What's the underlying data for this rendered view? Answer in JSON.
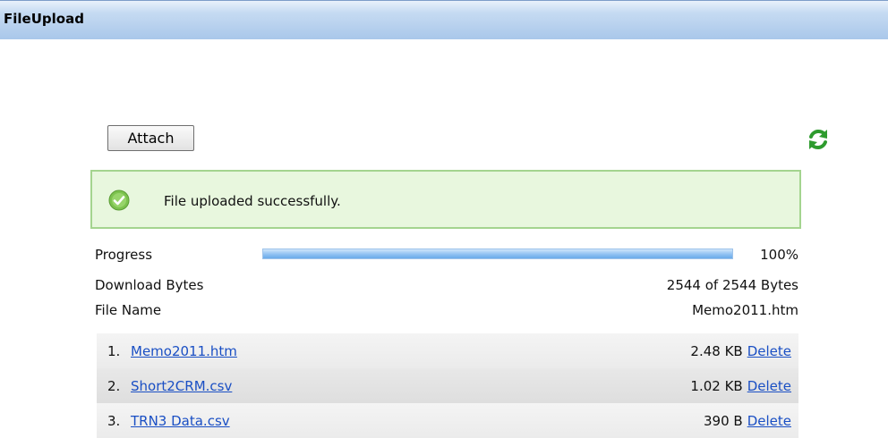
{
  "window": {
    "title": "FileUpload"
  },
  "toolbar": {
    "attach_label": "Attach",
    "refresh_icon": "refresh-icon"
  },
  "status": {
    "message": "File uploaded successfully.",
    "icon": "check-circle-icon"
  },
  "progress": {
    "label": "Progress",
    "percent": 100,
    "percent_text": "100%"
  },
  "download": {
    "label": "Download Bytes",
    "value": "2544 of 2544 Bytes"
  },
  "filename": {
    "label": "File Name",
    "value": "Memo2011.htm"
  },
  "files": [
    {
      "index": "1.",
      "name": "Memo2011.htm",
      "size": "2.48 KB",
      "delete_label": "Delete"
    },
    {
      "index": "2.",
      "name": "Short2CRM.csv",
      "size": "1.02 KB",
      "delete_label": "Delete"
    },
    {
      "index": "3.",
      "name": "TRN3 Data.csv",
      "size": "390 B",
      "delete_label": "Delete"
    }
  ],
  "colors": {
    "success_border": "#a4d48f",
    "success_bg": "#e8f7de",
    "link": "#1a4fc4",
    "progress": "#8fc1f2",
    "refresh_icon": "#2e9b2e"
  }
}
